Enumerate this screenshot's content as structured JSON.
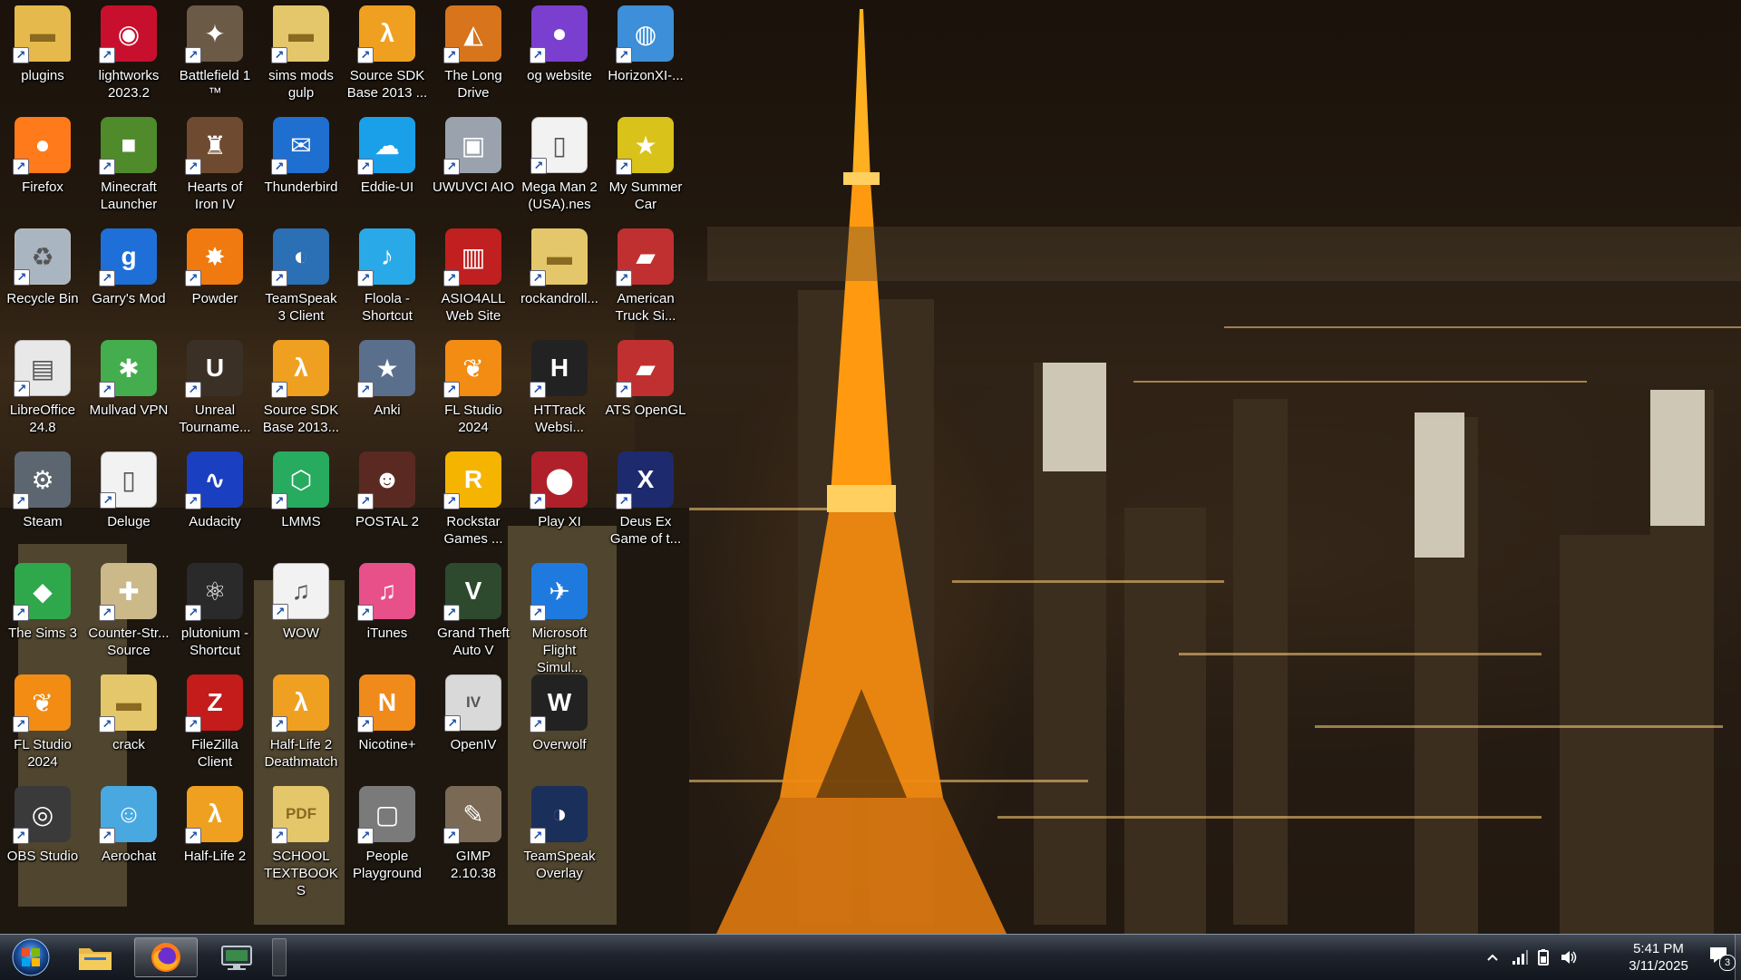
{
  "desktop": {
    "icons": [
      {
        "label": "plugins",
        "icon": "folder-icon",
        "color": "#e5b94b"
      },
      {
        "label": "lightworks 2023.2",
        "icon": "lightworks-icon",
        "color": "#c8102e"
      },
      {
        "label": "Battlefield 1 ™",
        "icon": "battlefield-icon",
        "color": "#6b5a45"
      },
      {
        "label": "sims mods gulp",
        "icon": "folder-icon",
        "color": "#e5c76b"
      },
      {
        "label": "Source SDK Base 2013 ...",
        "icon": "half-life-icon",
        "color": "#f0a020"
      },
      {
        "label": "The Long Drive",
        "icon": "car-icon",
        "color": "#d8741c"
      },
      {
        "label": "og website",
        "icon": "firefox-icon",
        "color": "#7b3fd0"
      },
      {
        "label": "HorizonXI-...",
        "icon": "globe-icon",
        "color": "#3c8fd8"
      },
      {
        "label": "Firefox",
        "icon": "firefox-icon",
        "color": "#ff7a1a"
      },
      {
        "label": "Minecraft Launcher",
        "icon": "minecraft-icon",
        "color": "#4f8a2b"
      },
      {
        "label": "Hearts of Iron IV",
        "icon": "hoi-icon",
        "color": "#6e4b30"
      },
      {
        "label": "Thunderbird",
        "icon": "thunderbird-icon",
        "color": "#1f6fd0"
      },
      {
        "label": "Eddie-UI",
        "icon": "cloud-icon",
        "color": "#1aa0e8"
      },
      {
        "label": "UWUVCI AIO",
        "icon": "console-icon",
        "color": "#9aa3ad"
      },
      {
        "label": "Mega Man 2 (USA).nes",
        "icon": "file-icon",
        "color": "#f2f2f2"
      },
      {
        "label": "My Summer Car",
        "icon": "summer-car-icon",
        "color": "#d9c21a"
      },
      {
        "label": "Recycle Bin",
        "icon": "recycle-bin-icon",
        "color": "#a9b6c2"
      },
      {
        "label": "Garry's Mod",
        "icon": "gmod-icon",
        "color": "#1e6fd8"
      },
      {
        "label": "Powder",
        "icon": "powder-icon",
        "color": "#f07a10"
      },
      {
        "label": "TeamSpeak 3 Client",
        "icon": "teamspeak-icon",
        "color": "#2b6fb5"
      },
      {
        "label": "Floola - Shortcut",
        "icon": "floola-icon",
        "color": "#2aa9e8"
      },
      {
        "label": "ASIO4ALL Web Site",
        "icon": "asio-icon",
        "color": "#c02020"
      },
      {
        "label": "rockandroll...",
        "icon": "folder-icon",
        "color": "#e5c76b"
      },
      {
        "label": "American Truck Si...",
        "icon": "truck-icon",
        "color": "#c03030"
      },
      {
        "label": "LibreOffice 24.8",
        "icon": "libreoffice-icon",
        "color": "#e8e8e8"
      },
      {
        "label": "Mullvad VPN",
        "icon": "mullvad-icon",
        "color": "#44ad4d"
      },
      {
        "label": "Unreal Tourname...",
        "icon": "unreal-icon",
        "color": "#3a3026"
      },
      {
        "label": "Source SDK Base 2013...",
        "icon": "half-life-icon",
        "color": "#f0a020"
      },
      {
        "label": "Anki",
        "icon": "anki-icon",
        "color": "#5a6f8c"
      },
      {
        "label": "FL Studio 2024",
        "icon": "fl-studio-icon",
        "color": "#f28c13"
      },
      {
        "label": "HTTrack Websi...",
        "icon": "httrack-icon",
        "color": "#222222"
      },
      {
        "label": "ATS OpenGL",
        "icon": "truck-icon",
        "color": "#c03030"
      },
      {
        "label": "Steam",
        "icon": "steam-icon",
        "color": "#5c6670"
      },
      {
        "label": "Deluge",
        "icon": "file-icon",
        "color": "#f2f2f2"
      },
      {
        "label": "Audacity",
        "icon": "audacity-icon",
        "color": "#1a3fc0"
      },
      {
        "label": "LMMS",
        "icon": "lmms-icon",
        "color": "#27ab5f"
      },
      {
        "label": "POSTAL 2",
        "icon": "postal-icon",
        "color": "#5a2a22"
      },
      {
        "label": "Rockstar Games ...",
        "icon": "rockstar-icon",
        "color": "#f5b400"
      },
      {
        "label": "Play XI",
        "icon": "playxi-icon",
        "color": "#b0202a"
      },
      {
        "label": "Deus Ex Game of t...",
        "icon": "deus-ex-icon",
        "color": "#1e2a6e"
      },
      {
        "label": "The Sims 3",
        "icon": "sims-icon",
        "color": "#2ea84a"
      },
      {
        "label": "Counter-Str... Source",
        "icon": "counter-strike-icon",
        "color": "#cbb98a"
      },
      {
        "label": "plutonium - Shortcut",
        "icon": "plutonium-icon",
        "color": "#2a2a2a"
      },
      {
        "label": "WOW",
        "icon": "wav-file-icon",
        "color": "#f2f2f2"
      },
      {
        "label": "iTunes",
        "icon": "itunes-icon",
        "color": "#e8508a"
      },
      {
        "label": "Grand Theft Auto V",
        "icon": "gta-icon",
        "color": "#2e4a2e"
      },
      {
        "label": "Microsoft Flight Simul...",
        "icon": "flight-sim-icon",
        "color": "#1f7ae0"
      },
      {
        "label": "",
        "icon": "",
        "color": ""
      },
      {
        "label": "FL Studio 2024",
        "icon": "fl-studio-icon",
        "color": "#f28c13"
      },
      {
        "label": "crack",
        "icon": "folder-icon",
        "color": "#e5c76b"
      },
      {
        "label": "FileZilla Client",
        "icon": "filezilla-icon",
        "color": "#c41b1b"
      },
      {
        "label": "Half-Life 2 Deathmatch",
        "icon": "half-life-icon",
        "color": "#f0a020"
      },
      {
        "label": "Nicotine+",
        "icon": "nicotine-icon",
        "color": "#f08a1a"
      },
      {
        "label": "OpenIV",
        "icon": "openiv-icon",
        "color": "#d9d9d9"
      },
      {
        "label": "Overwolf",
        "icon": "overwolf-icon",
        "color": "#222222"
      },
      {
        "label": "",
        "icon": "",
        "color": ""
      },
      {
        "label": "OBS Studio",
        "icon": "obs-icon",
        "color": "#3a3a3a"
      },
      {
        "label": "Aerochat",
        "icon": "aerochat-icon",
        "color": "#4aa8e0"
      },
      {
        "label": "Half-Life 2",
        "icon": "half-life-icon",
        "color": "#f0a020"
      },
      {
        "label": "SCHOOL TEXTBOOKS",
        "icon": "pdf-folder-icon",
        "color": "#e5c76b"
      },
      {
        "label": "People Playground",
        "icon": "people-playground-icon",
        "color": "#7a7a7a"
      },
      {
        "label": "GIMP 2.10.38",
        "icon": "gimp-icon",
        "color": "#7a6a55"
      },
      {
        "label": "TeamSpeak Overlay",
        "icon": "teamspeak-overlay-icon",
        "color": "#1a2f5a"
      },
      {
        "label": "",
        "icon": "",
        "color": ""
      }
    ]
  },
  "taskbar": {
    "start_icon": "windows-start-orb-icon",
    "pinned": [
      {
        "name": "file-explorer-taskbar-button",
        "icon": "folder-icon"
      },
      {
        "name": "firefox-taskbar-button",
        "icon": "firefox-icon",
        "active": true
      },
      {
        "name": "remote-desktop-taskbar-button",
        "icon": "monitor-icon"
      }
    ],
    "clock": {
      "time": "5:41 PM",
      "date": "3/11/2025"
    },
    "notifications": {
      "count": "3"
    }
  }
}
